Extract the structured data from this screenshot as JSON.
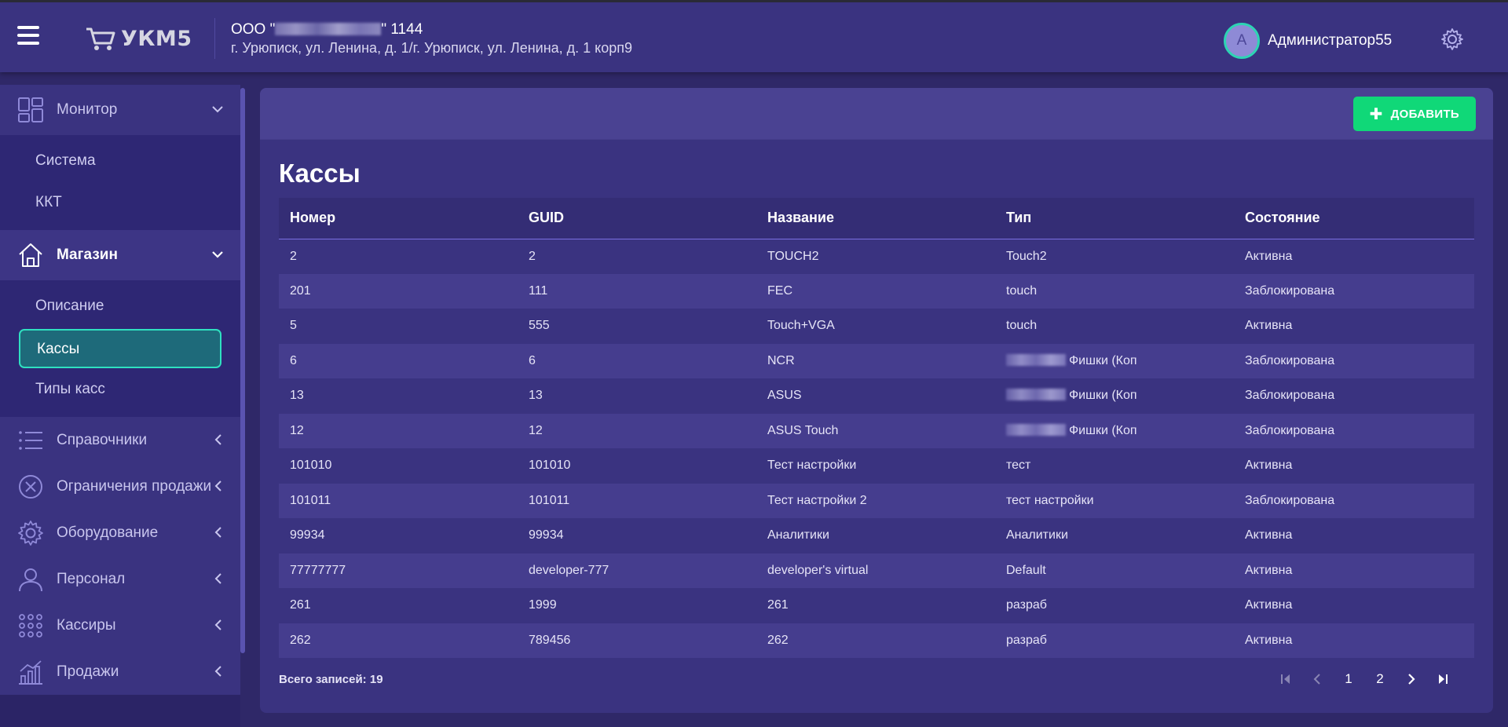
{
  "header": {
    "logo_text": "УКМ5",
    "org_prefix": "ООО \"",
    "org_suffix": "\" 1144",
    "address": "г. Урюписк, ул. Ленина, д. 1/г. Урюписк, ул. Ленина, д. 1 корп9",
    "user_initial": "А",
    "user_name": "Администратор55"
  },
  "sidebar": {
    "monitor": {
      "label": "Монитор",
      "items": [
        "Система",
        "ККТ"
      ]
    },
    "shop": {
      "label": "Магазин",
      "items": [
        "Описание",
        "Кассы",
        "Типы касс"
      ]
    },
    "sections": [
      "Справочники",
      "Ограничения продажи",
      "Оборудование",
      "Персонал",
      "Кассиры",
      "Продажи"
    ]
  },
  "page": {
    "title": "Кассы",
    "add_button": "ДОБАВИТЬ",
    "total": "Всего записей: 19"
  },
  "table": {
    "columns": [
      "Номер",
      "GUID",
      "Название",
      "Тип",
      "Состояние"
    ],
    "rows": [
      {
        "num": "2",
        "guid": "2",
        "name": "TOUCH2",
        "type": "Touch2",
        "state": "Активна"
      },
      {
        "num": "201",
        "guid": "111",
        "name": "FEC",
        "type": "touch",
        "state": "Заблокирована"
      },
      {
        "num": "5",
        "guid": "555",
        "name": "Touch+VGA",
        "type": "touch",
        "state": "Активна"
      },
      {
        "num": "6",
        "guid": "6",
        "name": "NCR",
        "type": "Фишки (Коп",
        "state": "Заблокирована"
      },
      {
        "num": "13",
        "guid": "13",
        "name": "ASUS",
        "type": "Фишки (Коп",
        "state": "Заблокирована"
      },
      {
        "num": "12",
        "guid": "12",
        "name": "ASUS Touch",
        "type": "Фишки (Коп",
        "state": "Заблокирована"
      },
      {
        "num": "101010",
        "guid": "101010",
        "name": "Тест настройки",
        "type": "тест",
        "state": "Активна"
      },
      {
        "num": "101011",
        "guid": "101011",
        "name": "Тест настройки 2",
        "type": "тест настройки",
        "state": "Заблокирована"
      },
      {
        "num": "99934",
        "guid": "99934",
        "name": "Аналитики",
        "type": "Аналитики",
        "state": "Активна"
      },
      {
        "num": "77777777",
        "guid": "developer-777",
        "name": "developer's virtual",
        "type": "Default",
        "state": "Активна"
      },
      {
        "num": "261",
        "guid": "1999",
        "name": "261",
        "type": "разраб",
        "state": "Активна"
      },
      {
        "num": "262",
        "guid": "789456",
        "name": "262",
        "type": "разраб",
        "state": "Активна"
      }
    ]
  },
  "pagination": {
    "pages": [
      "1",
      "2"
    ]
  }
}
